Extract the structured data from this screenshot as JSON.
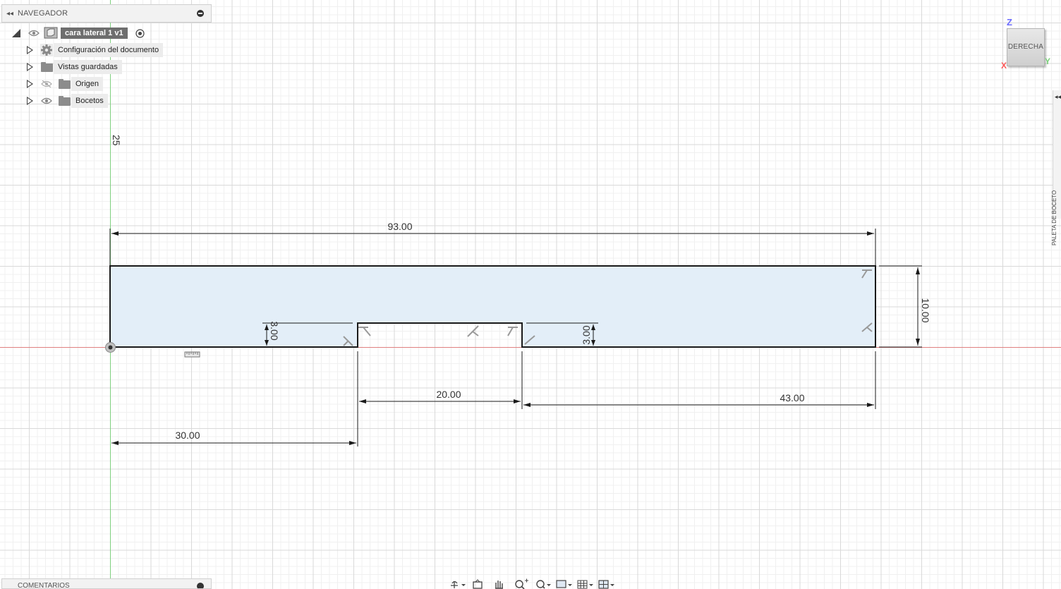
{
  "navigator": {
    "title": "NAVEGADOR",
    "root_label": "cara lateral 1 v1",
    "items": [
      {
        "label": "Configuración del documento",
        "icon": "gear-icon"
      },
      {
        "label": "Vistas guardadas",
        "icon": "folder-icon"
      },
      {
        "label": "Origen",
        "icon": "folder-icon"
      },
      {
        "label": "Bocetos",
        "icon": "folder-icon"
      }
    ]
  },
  "comments": {
    "title": "COMENTARIOS"
  },
  "viewcube": {
    "face_label": "DERECHA",
    "axis_z": "Z",
    "axis_x": "X",
    "axis_y": "Y"
  },
  "palette": {
    "label": "PALETA DE BOCETO"
  },
  "canvas": {
    "grid_label": "25"
  },
  "sketch": {
    "dimensions": {
      "total_width": "93.00",
      "height": "10.00",
      "notch_width": "20.00",
      "right_offset": "43.00",
      "left_offset": "30.00",
      "notch_depth_left": "3.00",
      "notch_depth_right": "3.00"
    }
  },
  "colors": {
    "profile_fill": "#e3eef8",
    "origin_axis_green": "#7fd07f",
    "origin_axis_red": "#e08080"
  }
}
